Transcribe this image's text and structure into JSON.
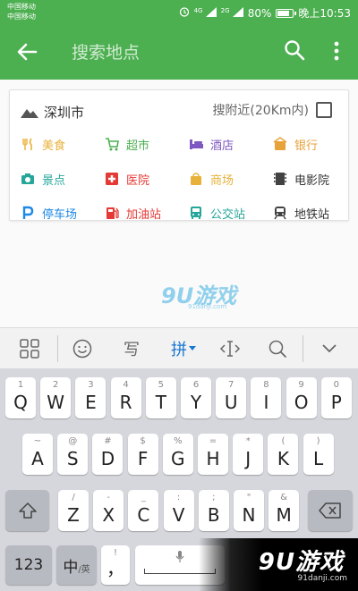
{
  "status_bar": {
    "carrier_1": "中国移动",
    "carrier_2": "中国移动",
    "signal_1": "4G",
    "signal_2": "2G",
    "battery": "80%",
    "battery_level": 0.8,
    "time": "晚上10:53"
  },
  "app_bar": {
    "search_placeholder": "搜索地点",
    "back_icon": "arrow-left-icon",
    "search_icon": "search-icon",
    "more_icon": "more-vert-icon"
  },
  "location_card": {
    "city": "深圳市",
    "nearby_label": "搜附近(20Km内)",
    "nearby_checked": false,
    "categories": [
      {
        "label": "美食",
        "icon": "food-icon",
        "color": "#e8b23a"
      },
      {
        "label": "超市",
        "icon": "cart-icon",
        "color": "#4caf50"
      },
      {
        "label": "酒店",
        "icon": "bed-icon",
        "color": "#7e57c2"
      },
      {
        "label": "银行",
        "icon": "bank-icon",
        "color": "#e8a23a"
      },
      {
        "label": "景点",
        "icon": "camera-icon",
        "color": "#26a69a"
      },
      {
        "label": "医院",
        "icon": "hospital-icon",
        "color": "#e53935"
      },
      {
        "label": "商场",
        "icon": "shopping-bag-icon",
        "color": "#e8b23a"
      },
      {
        "label": "电影院",
        "icon": "film-icon",
        "color": "#424242"
      },
      {
        "label": "停车场",
        "icon": "parking-icon",
        "color": "#1e88e5"
      },
      {
        "label": "加油站",
        "icon": "gas-station-icon",
        "color": "#e53935"
      },
      {
        "label": "公交站",
        "icon": "bus-icon",
        "color": "#26a69a"
      },
      {
        "label": "地铁站",
        "icon": "subway-icon",
        "color": "#424242"
      }
    ]
  },
  "keyboard_toolbar": {
    "pinyin_label": "拼",
    "handwrite_label": "写"
  },
  "keyboard": {
    "row1": [
      {
        "main": "Q",
        "sub": "1"
      },
      {
        "main": "W",
        "sub": "2"
      },
      {
        "main": "E",
        "sub": "3"
      },
      {
        "main": "R",
        "sub": "4"
      },
      {
        "main": "T",
        "sub": "5"
      },
      {
        "main": "Y",
        "sub": "6"
      },
      {
        "main": "U",
        "sub": "7"
      },
      {
        "main": "I",
        "sub": "8"
      },
      {
        "main": "O",
        "sub": "9"
      },
      {
        "main": "P",
        "sub": "0"
      }
    ],
    "row2": [
      {
        "main": "A",
        "sub": "~"
      },
      {
        "main": "S",
        "sub": "@"
      },
      {
        "main": "D",
        "sub": "#"
      },
      {
        "main": "F",
        "sub": "$"
      },
      {
        "main": "G",
        "sub": "%"
      },
      {
        "main": "H",
        "sub": "="
      },
      {
        "main": "J",
        "sub": "*"
      },
      {
        "main": "K",
        "sub": "("
      },
      {
        "main": "L",
        "sub": ")"
      }
    ],
    "row3": [
      {
        "main": "Z",
        "sub": "/"
      },
      {
        "main": "X",
        "sub": "-"
      },
      {
        "main": "C",
        "sub": "_"
      },
      {
        "main": "V",
        "sub": ":"
      },
      {
        "main": "B",
        "sub": ";"
      },
      {
        "main": "N",
        "sub": "\""
      },
      {
        "main": "M",
        "sub": "&"
      }
    ],
    "num_label": "123",
    "lang_main": "中",
    "lang_sub": "/英",
    "comma_main": "，",
    "comma_sub": "!"
  },
  "watermark": {
    "logo": "9U游戏",
    "url": "91danji.com",
    "center_logo": "9U游戏",
    "center_url": "91danji.com"
  }
}
